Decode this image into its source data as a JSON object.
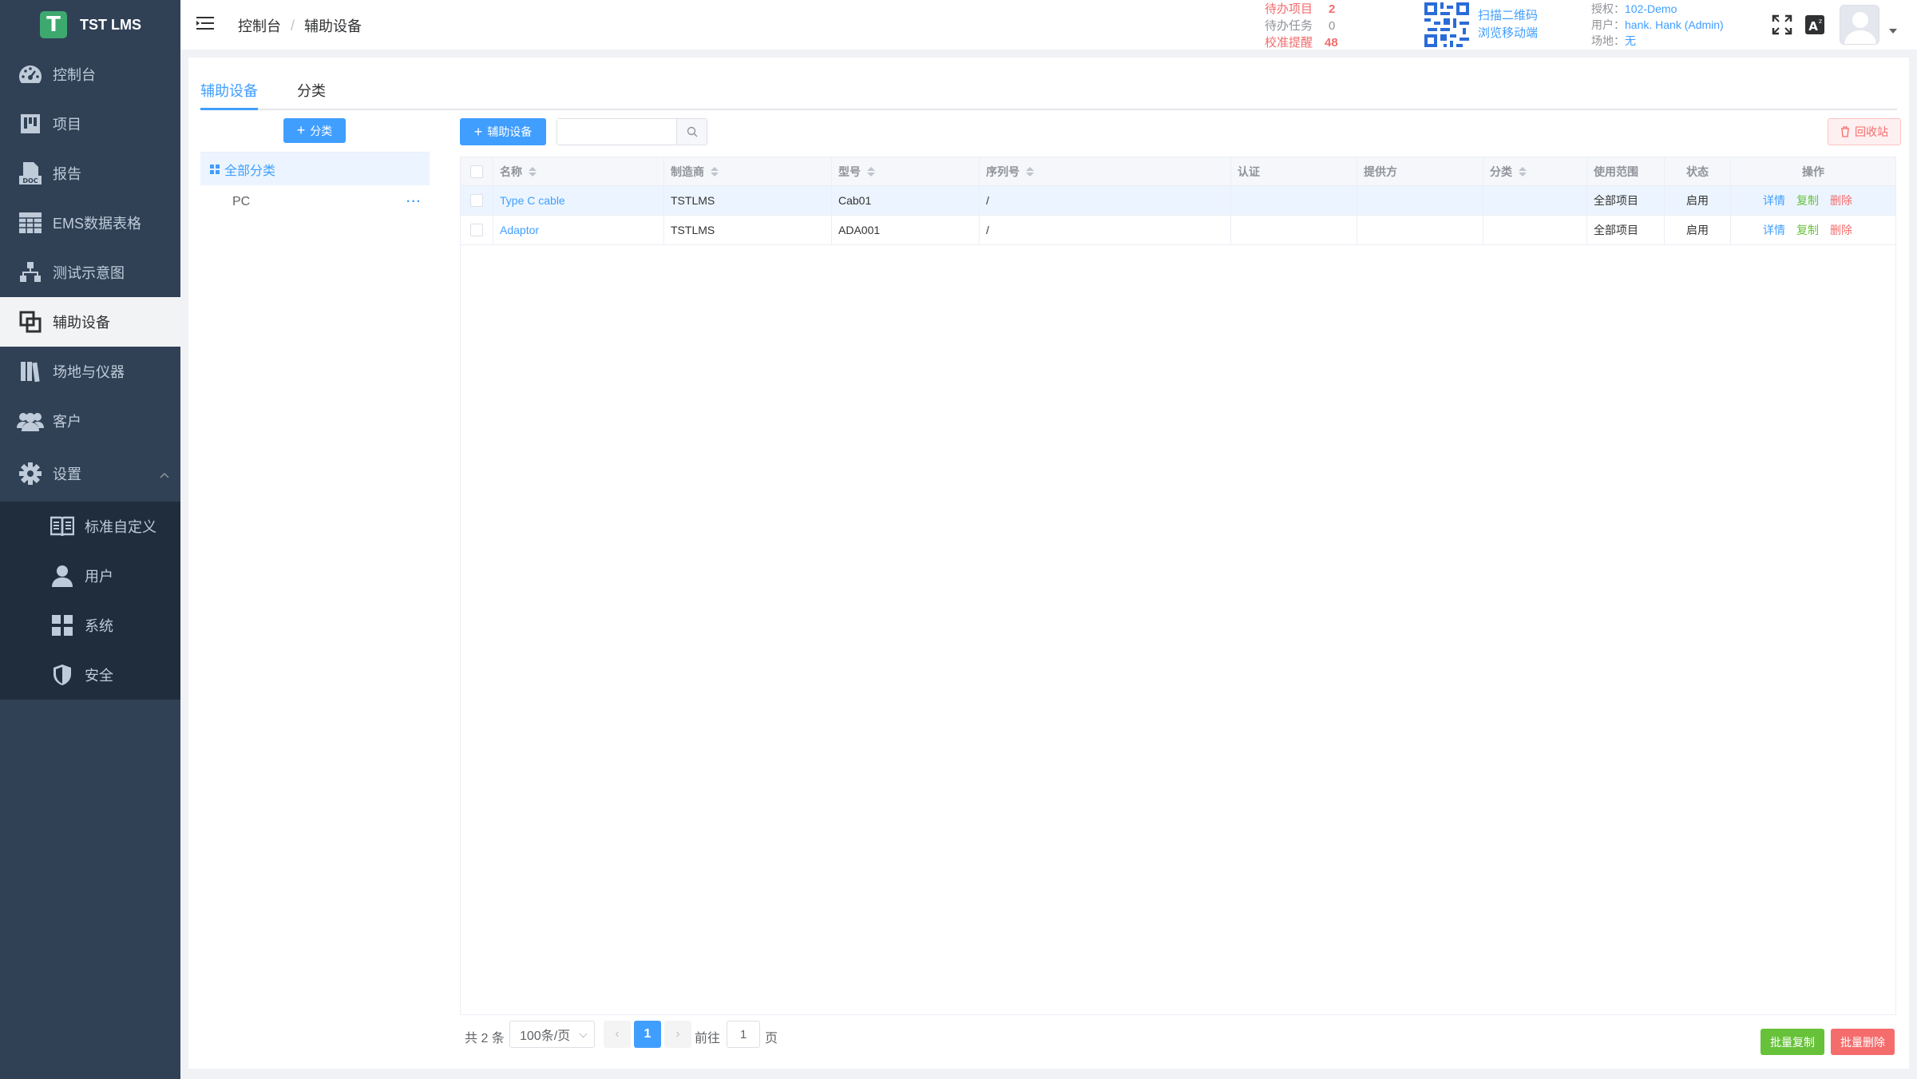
{
  "app": {
    "logo_letter": "T",
    "title": "TST LMS"
  },
  "sidebar": {
    "items": [
      {
        "label": "控制台",
        "icon": "dashboard-icon"
      },
      {
        "label": "项目",
        "icon": "project-board-icon"
      },
      {
        "label": "报告",
        "icon": "doc-report-icon"
      },
      {
        "label": "EMS数据表格",
        "icon": "table-icon"
      },
      {
        "label": "测试示意图",
        "icon": "sitemap-icon"
      },
      {
        "label": "辅助设备",
        "icon": "clone-icon",
        "active": true
      },
      {
        "label": "场地与仪器",
        "icon": "books-icon"
      },
      {
        "label": "客户",
        "icon": "users-icon"
      }
    ],
    "settings": {
      "label": "设置",
      "icon": "gear-icon",
      "expanded": true
    },
    "submenu": [
      {
        "label": "标准自定义",
        "icon": "book-open-icon"
      },
      {
        "label": "用户",
        "icon": "user-icon"
      },
      {
        "label": "系统",
        "icon": "apps-grid-icon"
      },
      {
        "label": "安全",
        "icon": "shield-icon"
      }
    ]
  },
  "header": {
    "breadcrumb": [
      "控制台",
      "辅助设备"
    ],
    "breadcrumb_sep": "/",
    "todo": [
      {
        "label": "待办项目",
        "value": "2",
        "color": "#f56c6c"
      },
      {
        "label": "待办任务",
        "value": "0",
        "color": "#909399"
      },
      {
        "label": "校准提醒",
        "value": "48",
        "color": "#f56c6c"
      }
    ],
    "qr": {
      "line1": "扫描二维码",
      "line2": "浏览移动端"
    },
    "auth": [
      {
        "label": "授权：",
        "value": "102-Demo"
      },
      {
        "label": "用户：",
        "value": "hank. Hank (Admin)"
      },
      {
        "label": "场地：",
        "value": "无"
      }
    ]
  },
  "tabs": [
    {
      "label": "辅助设备",
      "active": true
    },
    {
      "label": "分类",
      "active": false
    }
  ],
  "tree": {
    "add_label": "分类",
    "all_label": "全部分类",
    "nodes": [
      {
        "label": "PC",
        "more": "···"
      }
    ]
  },
  "toolbar": {
    "add_label": "辅助设备",
    "search_placeholder": "",
    "recycle_label": "回收站"
  },
  "table": {
    "columns": [
      "名称",
      "制造商",
      "型号",
      "序列号",
      "认证",
      "提供方",
      "分类",
      "使用范围",
      "状态",
      "操作"
    ],
    "rows": [
      {
        "name": "Type C cable",
        "maker": "TSTLMS",
        "model": "Cab01",
        "serial": "/",
        "cert": "",
        "provider": "",
        "category": "",
        "scope": "全部项目",
        "status": "启用",
        "ops": [
          "详情",
          "复制",
          "删除"
        ]
      },
      {
        "name": "Adaptor",
        "maker": "TSTLMS",
        "model": "ADA001",
        "serial": "/",
        "cert": "",
        "provider": "",
        "category": "",
        "scope": "全部项目",
        "status": "启用",
        "ops": [
          "详情",
          "复制",
          "删除"
        ]
      }
    ]
  },
  "pagination": {
    "total_text": "共 2 条",
    "page_size": "100条/页",
    "current_page": "1",
    "goto_label": "前往",
    "goto_value": "1",
    "page_unit": "页",
    "prev": "‹",
    "next": "›"
  },
  "footer_buttons": {
    "batch_copy": "批量复制",
    "batch_delete": "批量删除"
  },
  "colors": {
    "sidebar": "#304156",
    "accent": "#409eff",
    "danger": "#f56c6c",
    "success": "#67c23a"
  }
}
